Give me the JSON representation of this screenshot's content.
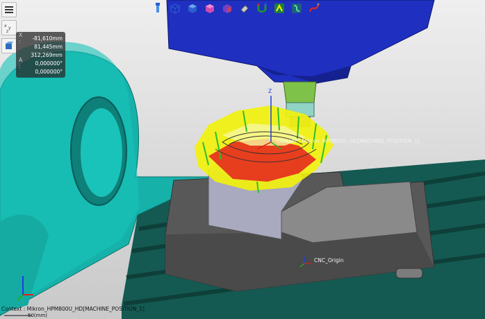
{
  "toolbar_top": {
    "icons": [
      "tool-icon",
      "view-cube-icon",
      "solid-view-icon",
      "wireframe-view-icon",
      "shaded-view-icon",
      "eraser-icon",
      "magnet-icon",
      "collision-icon",
      "path-icon",
      "settings-icon"
    ]
  },
  "toolbar_side": {
    "icons": [
      "menu-icon",
      "axis-icon",
      "part-icon"
    ]
  },
  "coords": {
    "x": {
      "label": "X :",
      "value": "-81,610mm"
    },
    "y": {
      "label": "",
      "value": "81,445mm"
    },
    "z": {
      "label": "",
      "value": "312,269mm"
    },
    "a": {
      "label": "A :",
      "value": "0,000000°"
    },
    "c": {
      "label": "",
      "value": "0,000000°"
    }
  },
  "labels": {
    "context_tool": "Context : Mikron_HPM800U_HD[MACHINE_POSITION_1]",
    "cnc_origin": "CNC_Origin",
    "axis_z": "Z",
    "status_context": "Context : Mikron_HPM800U_HD[MACHINE_POSITION_1]",
    "scale": "50(mm)"
  },
  "colors": {
    "spindle": "#1f2fbf",
    "fixture": "#14b8b0",
    "table": "#155d55",
    "vise": "#5a5a5a",
    "toolpath_yellow": "#f2f20a",
    "toolpath_red": "#e51e1e",
    "toolpath_green": "#2bbf2b"
  }
}
